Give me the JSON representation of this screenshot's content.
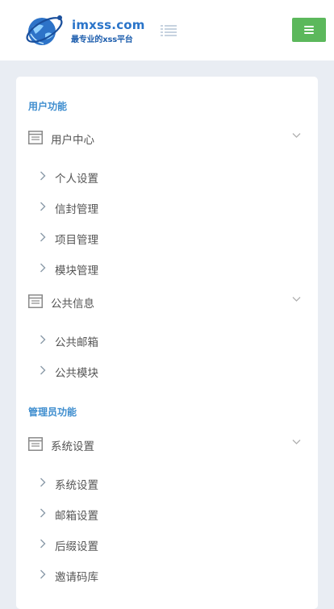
{
  "header": {
    "logo_title": "imxss.com",
    "logo_subtitle": "最专业的xss平台",
    "logo_icon": "globe-logo",
    "list_toggle_icon": "list-icon",
    "menu_button_icon": "hamburger-icon",
    "menu_button_color": "#5cb85c"
  },
  "sidebar": {
    "sections": [
      {
        "title": "用户功能",
        "groups": [
          {
            "label": "用户中心",
            "icon": "window-icon",
            "items": [
              "个人设置",
              "信封管理",
              "项目管理",
              "模块管理"
            ]
          },
          {
            "label": "公共信息",
            "icon": "window-icon",
            "items": [
              "公共邮箱",
              "公共模块"
            ]
          }
        ]
      },
      {
        "title": "管理员功能",
        "groups": [
          {
            "label": "系统设置",
            "icon": "window-icon",
            "items": [
              "系统设置",
              "邮箱设置",
              "后缀设置",
              "邀请码库"
            ]
          }
        ]
      }
    ]
  },
  "colors": {
    "accent": "#3f8ecf",
    "page_background": "#e9edf3"
  }
}
